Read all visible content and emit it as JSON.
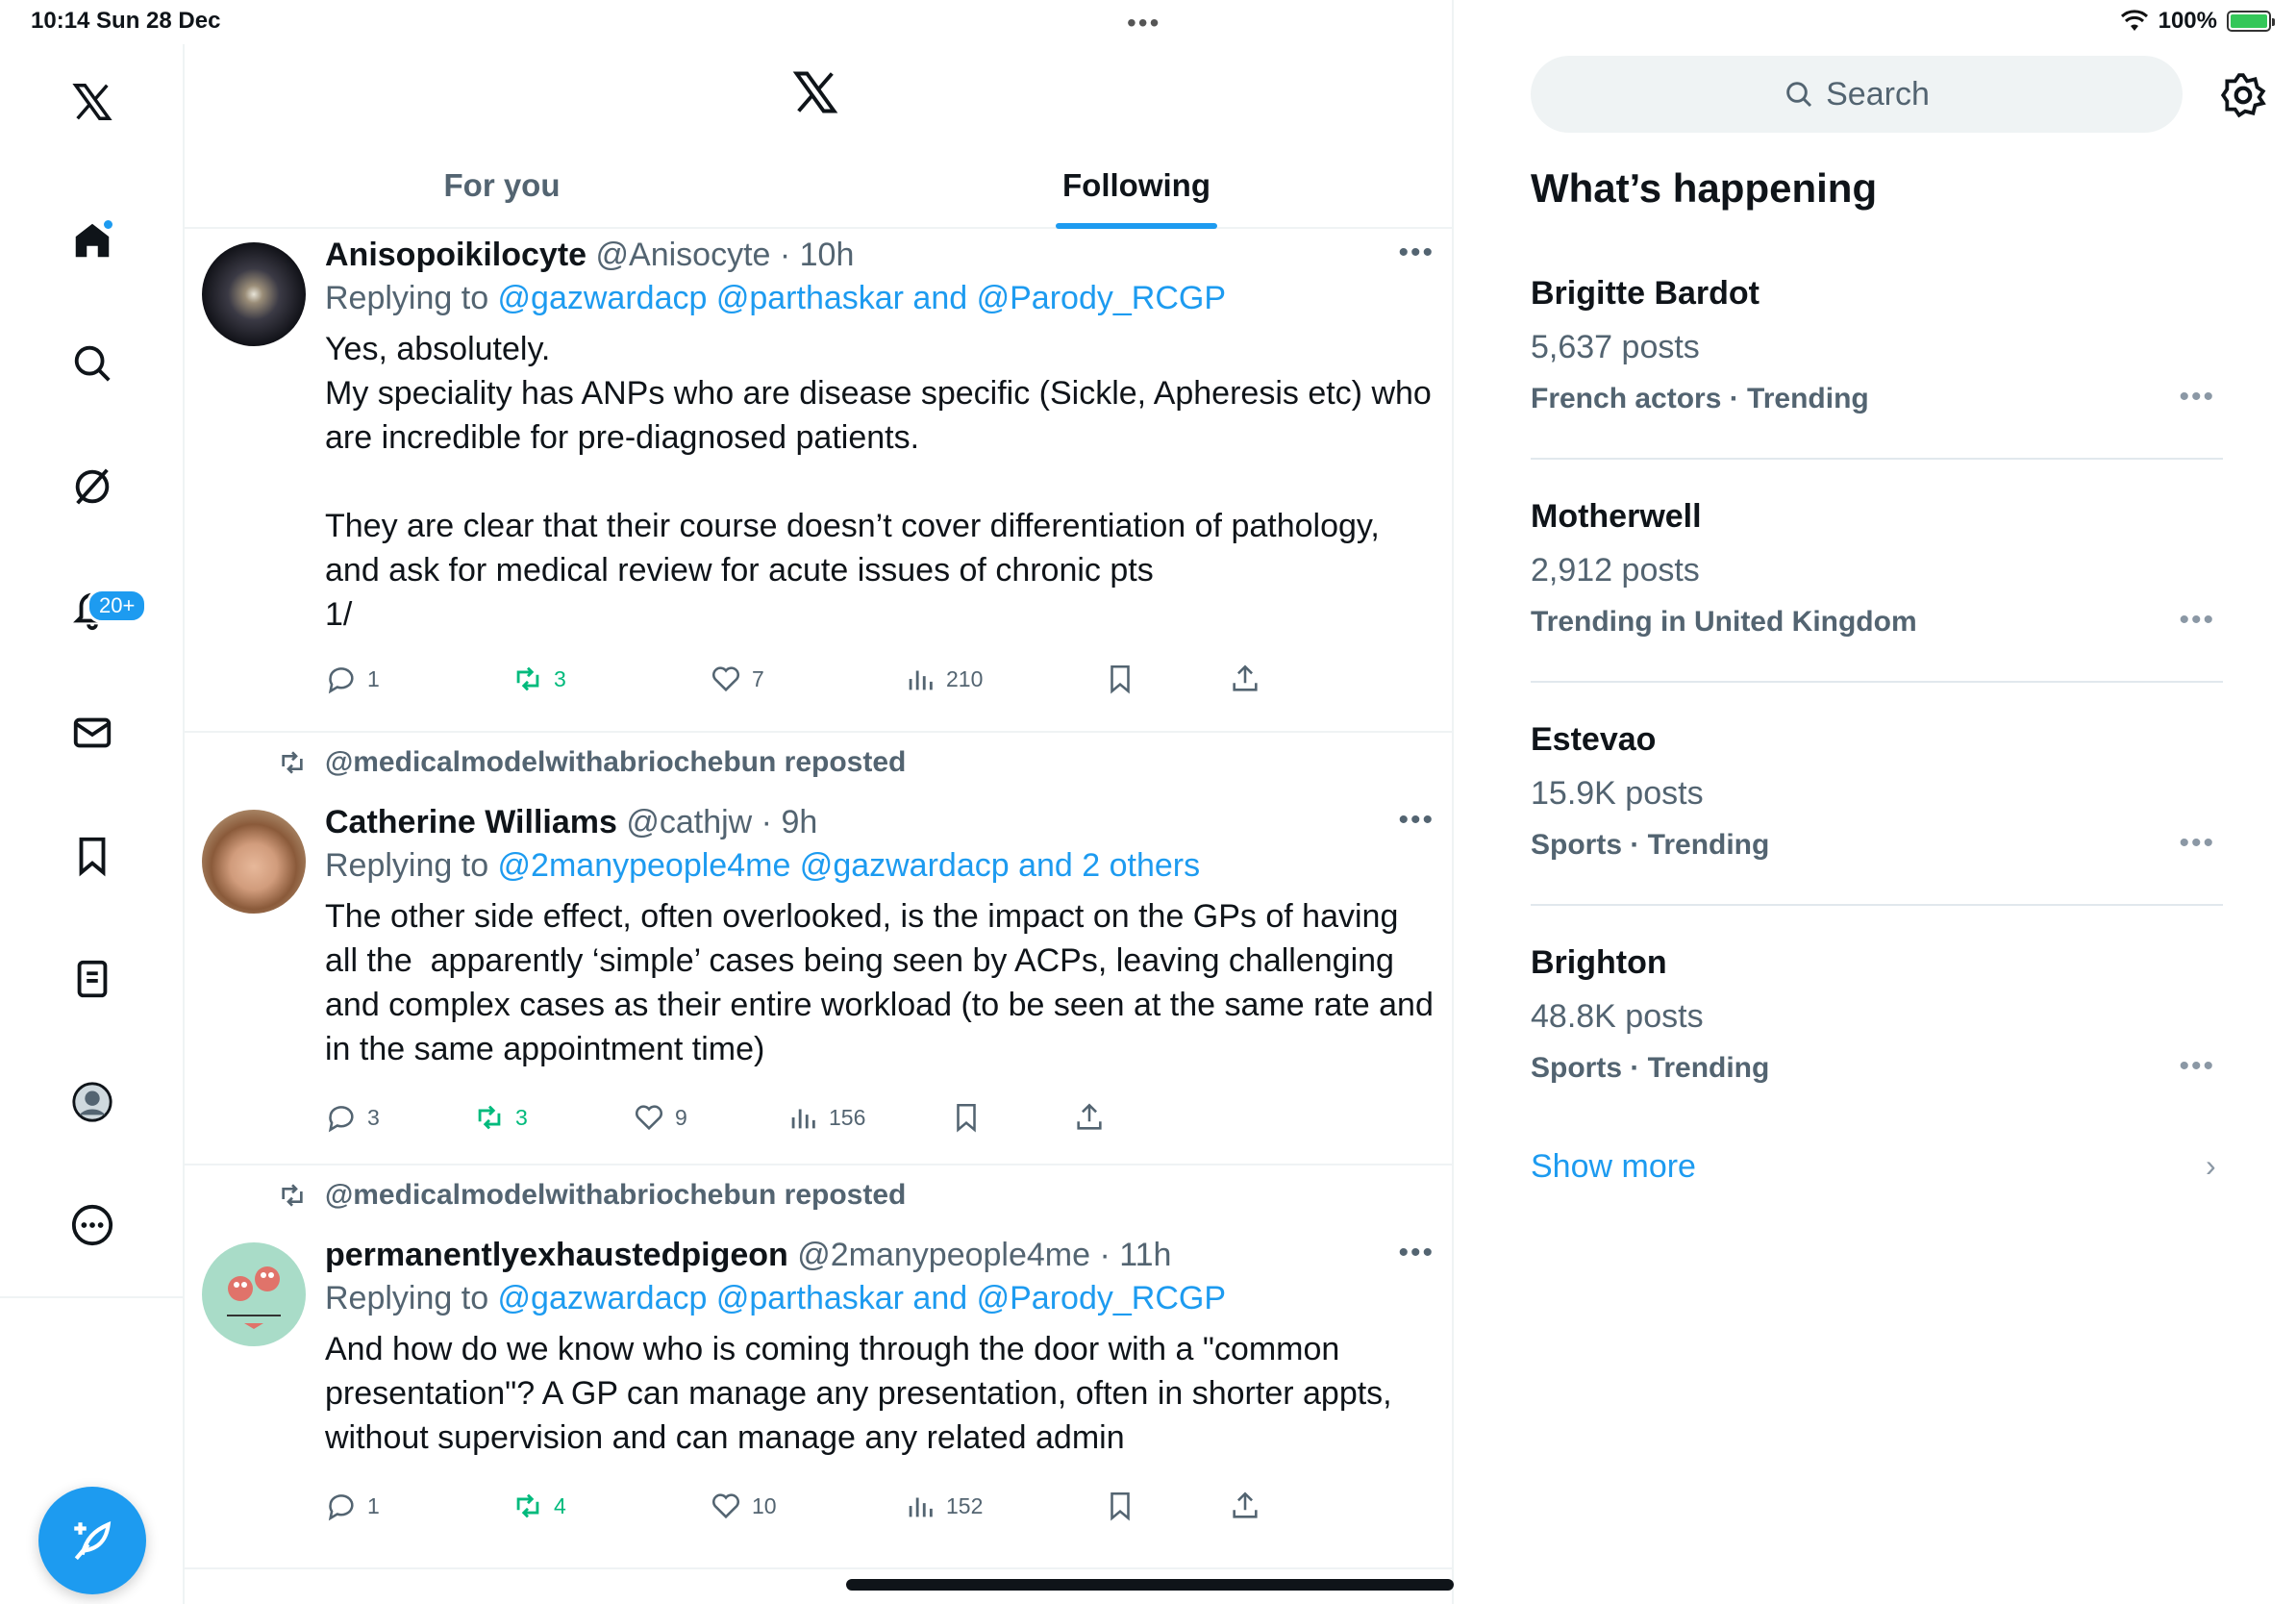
{
  "status_bar": {
    "time": "10:14  Sun 28 Dec",
    "battery": "100%"
  },
  "tabs": [
    {
      "label": "For you",
      "active": false
    },
    {
      "label": "Following",
      "active": true
    }
  ],
  "nav": {
    "notifications_badge": "20+"
  },
  "tweets": [
    {
      "name": "Anisopoikilocyte",
      "meta": " @Anisocyte · 10h",
      "reply_prefix": "Replying to ",
      "reply_targets": "@gazwardacp @parthaskar and @Parody_RCGP",
      "text": "Yes, absolutely.\nMy speciality has ANPs who are disease specific (Sickle, Apheresis etc) who\nare incredible for pre-diagnosed patients.\n\nThey are clear that their course doesn’t cover differentiation of pathology,\nand ask for medical review for acute issues of chronic pts\n1/",
      "replies": "1",
      "reposts": "3",
      "likes": "7",
      "views": "210"
    },
    {
      "repost_label": "@medicalmodelwithabriochebun reposted",
      "name": "Catherine Williams",
      "meta": " @cathjw · 9h",
      "reply_prefix": "Replying to ",
      "reply_targets": "@2manypeople4me @gazwardacp and 2 others",
      "text": "The other side effect, often overlooked, is the impact on the GPs of having\nall the  apparently ‘simple’ cases being seen by ACPs, leaving challenging\nand complex cases as their entire workload (to be seen at the same rate and\nin the same appointment time)",
      "replies": "3",
      "reposts": "3",
      "likes": "9",
      "views": "156"
    },
    {
      "repost_label": "@medicalmodelwithabriochebun reposted",
      "name": "permanentlyexhaustedpigeon",
      "meta": " @2manypeople4me · 11h",
      "reply_prefix": "Replying to ",
      "reply_targets": "@gazwardacp @parthaskar and @Parody_RCGP",
      "text": "And how do we know who is coming through the door with a \"common\npresentation\"? A GP can manage any presentation, often in shorter appts,\nwithout supervision and can manage any related admin",
      "replies": "1",
      "reposts": "4",
      "likes": "10",
      "views": "152"
    }
  ],
  "search": {
    "placeholder": "Search"
  },
  "whats_happening": {
    "title": "What’s happening",
    "trends": [
      {
        "name": "Brigitte Bardot",
        "count": "5,637 posts",
        "category": "French actors · Trending"
      },
      {
        "name": "Motherwell",
        "count": "2,912 posts",
        "category": "Trending in United Kingdom"
      },
      {
        "name": "Estevao",
        "count": "15.9K posts",
        "category": "Sports · Trending"
      },
      {
        "name": "Brighton",
        "count": "48.8K posts",
        "category": "Sports · Trending"
      }
    ],
    "show_more": "Show more"
  },
  "colors": {
    "accent": "#1d9bf0",
    "repost_green": "#00ba7c",
    "muted": "#536471",
    "text": "#0f1419"
  },
  "icons": {
    "nav": [
      "x-logo",
      "home-icon",
      "search-icon",
      "grok-icon",
      "bell-icon",
      "mail-icon",
      "bookmark-icon",
      "list-icon",
      "profile-icon",
      "more-icon"
    ],
    "compose": "compose-feather-icon"
  }
}
